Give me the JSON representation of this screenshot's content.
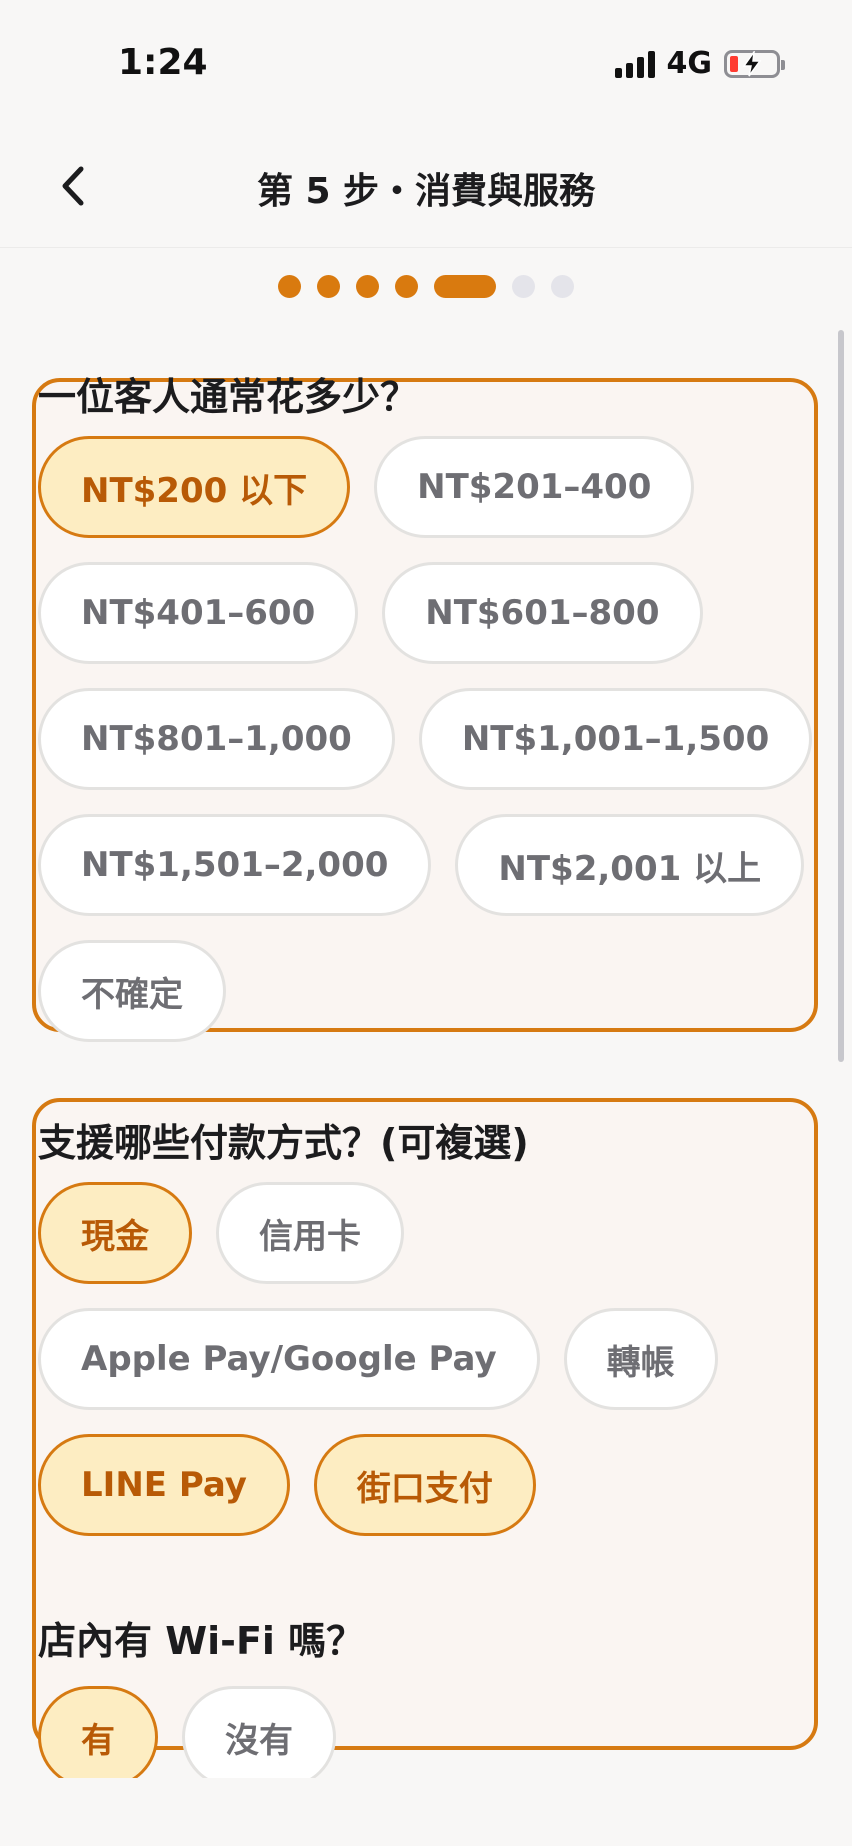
{
  "status_bar": {
    "time": "1:24",
    "network": "4G",
    "battery_state": "low-charging"
  },
  "header": {
    "title": "第 5 步・消費與服務",
    "back_icon": "chevron-left-icon"
  },
  "progress": {
    "total_steps": 7,
    "current_step": 5
  },
  "spending": {
    "question": "一位客人通常花多少？",
    "options": [
      "NT$200 以下",
      "NT$201–400",
      "NT$401–600",
      "NT$601–800",
      "NT$801–1,000",
      "NT$1,001–1,500",
      "NT$1,501–2,000",
      "NT$2,001 以上",
      "不確定"
    ],
    "selected": [
      "NT$200 以下"
    ]
  },
  "payments": {
    "question": "支援哪些付款方式？(可複選)",
    "options": [
      "現金",
      "信用卡",
      "Apple Pay/Google Pay",
      "轉帳",
      "LINE Pay",
      "街口支付"
    ],
    "selected": [
      "現金",
      "LINE Pay",
      "街口支付"
    ]
  },
  "wifi": {
    "question": "店內有 Wi-Fi 嗎？",
    "options": [
      "有",
      "沒有"
    ],
    "selected": [
      "有"
    ]
  },
  "colors": {
    "accent": "#D67A12",
    "selected_bg": "#FDEDC2",
    "selected_text": "#B85A06",
    "chip_text": "#6E6E73",
    "chip_border": "#E3E2E0"
  }
}
